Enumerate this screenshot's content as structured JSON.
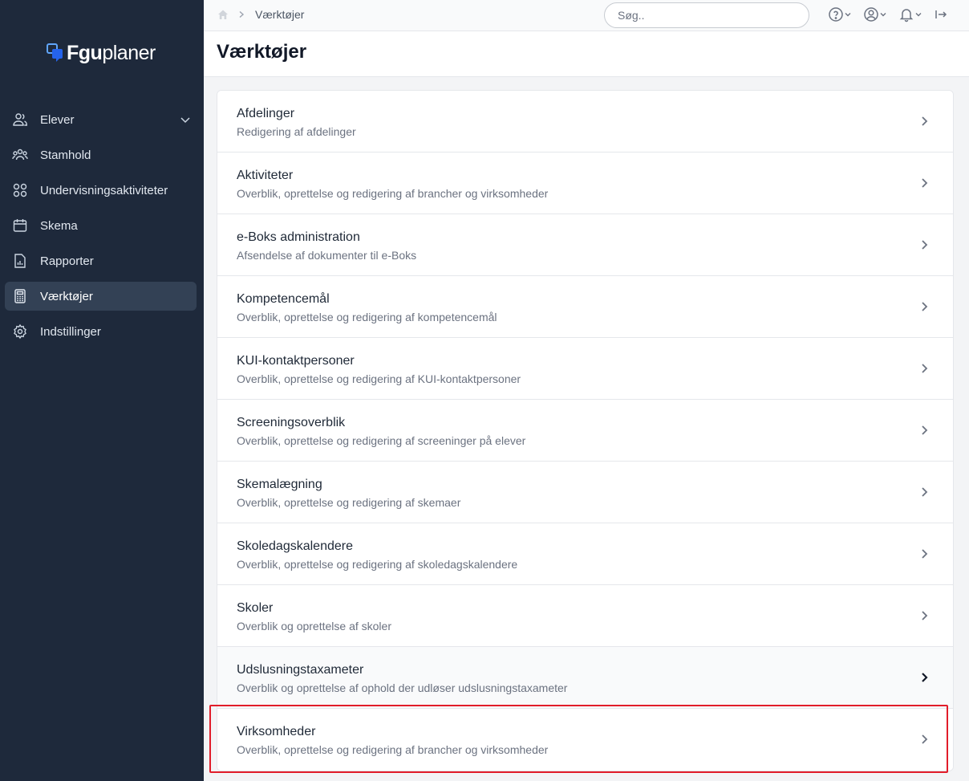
{
  "app": {
    "logo_bold": "Fgu",
    "logo_light": "planer"
  },
  "sidebar": {
    "items": [
      {
        "label": "Elever"
      },
      {
        "label": "Stamhold"
      },
      {
        "label": "Undervisningsaktiviteter"
      },
      {
        "label": "Skema"
      },
      {
        "label": "Rapporter"
      },
      {
        "label": "Værktøjer"
      },
      {
        "label": "Indstillinger"
      }
    ]
  },
  "topbar": {
    "breadcrumb": "Værktøjer",
    "search_placeholder": "Søg.."
  },
  "page": {
    "title": "Værktøjer"
  },
  "tools": [
    {
      "title": "Afdelinger",
      "desc": "Redigering af afdelinger"
    },
    {
      "title": "Aktiviteter",
      "desc": "Overblik, oprettelse og redigering af brancher og virksomheder"
    },
    {
      "title": "e-Boks administration",
      "desc": "Afsendelse af dokumenter til e-Boks"
    },
    {
      "title": "Kompetencemål",
      "desc": "Overblik, oprettelse og redigering af kompetencemål"
    },
    {
      "title": "KUI-kontaktpersoner",
      "desc": "Overblik, oprettelse og redigering af KUI-kontaktpersoner"
    },
    {
      "title": "Screeningsoverblik",
      "desc": "Overblik, oprettelse og redigering af screeninger på elever"
    },
    {
      "title": "Skemalægning",
      "desc": "Overblik, oprettelse og redigering af skemaer"
    },
    {
      "title": "Skoledagskalendere",
      "desc": "Overblik, oprettelse og redigering af skoledagskalendere"
    },
    {
      "title": "Skoler",
      "desc": "Overblik og oprettelse af skoler"
    },
    {
      "title": "Udslusningstaxameter",
      "desc": "Overblik og oprettelse af ophold der udløser udslusningstaxameter"
    },
    {
      "title": "Virksomheder",
      "desc": "Overblik, oprettelse og redigering af brancher og virksomheder"
    }
  ],
  "colors": {
    "sidebar_bg": "#1e293b",
    "active_item_bg": "#334155",
    "highlight_border": "#e11d2a"
  }
}
